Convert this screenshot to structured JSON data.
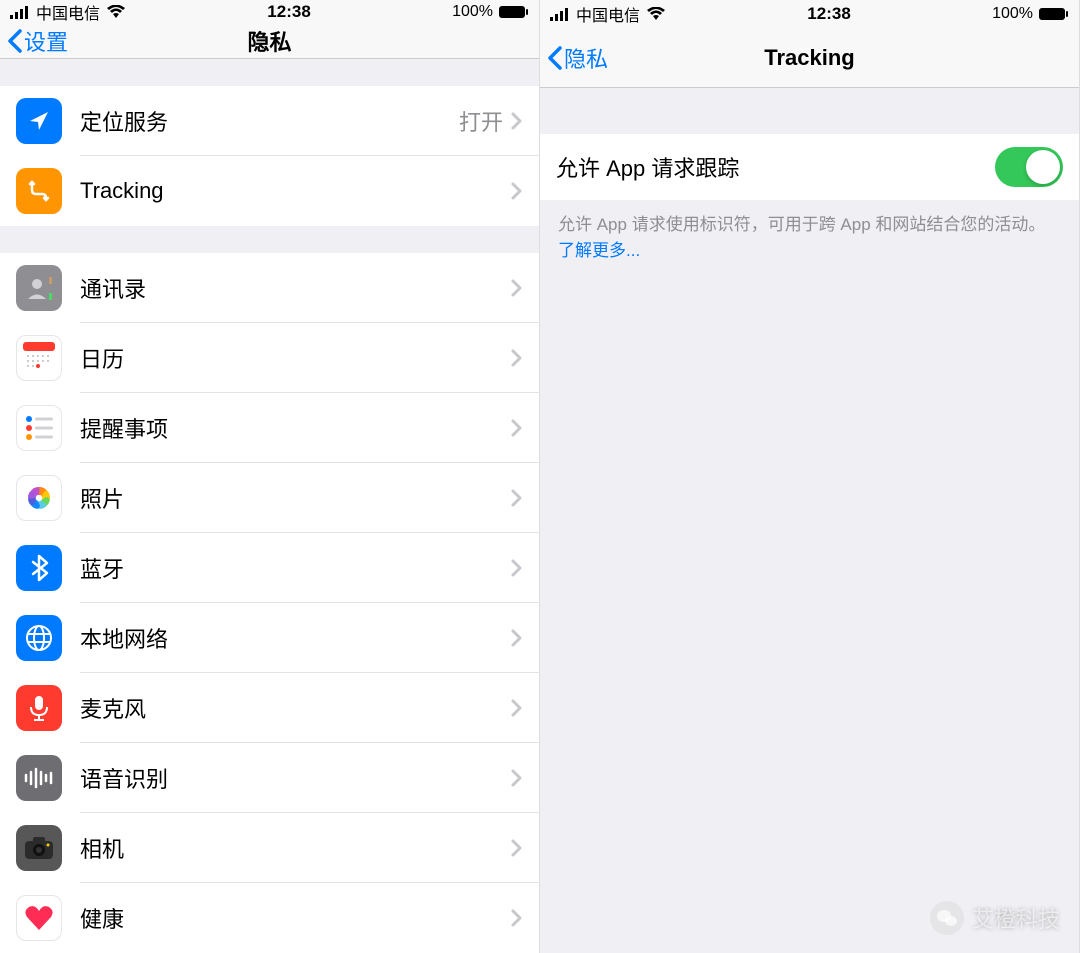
{
  "status": {
    "carrier": "中国电信",
    "time": "12:38",
    "battery": "100%"
  },
  "left": {
    "back": "设置",
    "title": "隐私",
    "group1": [
      {
        "icon": "location-icon",
        "bg": "bg-blue",
        "label": "定位服务",
        "value": "打开"
      },
      {
        "icon": "tracking-icon",
        "bg": "bg-orange",
        "label": "Tracking",
        "value": ""
      }
    ],
    "group2": [
      {
        "icon": "contacts-icon",
        "bg": "bg-gray",
        "label": "通讯录"
      },
      {
        "icon": "calendar-icon",
        "bg": "bg-white",
        "label": "日历"
      },
      {
        "icon": "reminders-icon",
        "bg": "bg-white",
        "label": "提醒事项"
      },
      {
        "icon": "photos-icon",
        "bg": "bg-white",
        "label": "照片"
      },
      {
        "icon": "bluetooth-icon",
        "bg": "bg-blue",
        "label": "蓝牙"
      },
      {
        "icon": "network-icon",
        "bg": "bg-blue",
        "label": "本地网络"
      },
      {
        "icon": "microphone-icon",
        "bg": "bg-red",
        "label": "麦克风"
      },
      {
        "icon": "speech-icon",
        "bg": "bg-darkgray",
        "label": "语音识别"
      },
      {
        "icon": "camera-icon",
        "bg": "bg-darkgray2",
        "label": "相机"
      },
      {
        "icon": "health-icon",
        "bg": "bg-white",
        "label": "健康"
      }
    ]
  },
  "right": {
    "back": "隐私",
    "title": "Tracking",
    "toggle_label": "允许 App 请求跟踪",
    "toggle_on": true,
    "footer": "允许 App 请求使用标识符，可用于跨 App 和网站结合您的活动。",
    "footer_link": "了解更多..."
  },
  "watermark": "艾橙科技"
}
